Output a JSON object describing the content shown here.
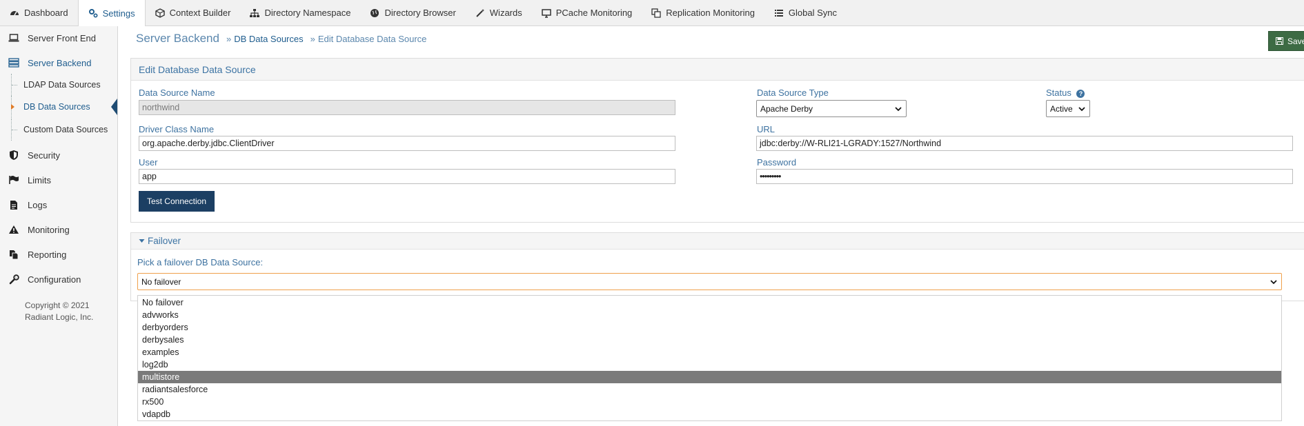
{
  "topnav": {
    "tabs": [
      {
        "label": "Dashboard",
        "icon": "dashboard-icon"
      },
      {
        "label": "Settings",
        "icon": "gears-icon"
      },
      {
        "label": "Context Builder",
        "icon": "cube-icon"
      },
      {
        "label": "Directory Namespace",
        "icon": "sitemap-icon"
      },
      {
        "label": "Directory Browser",
        "icon": "globe-icon"
      },
      {
        "label": "Wizards",
        "icon": "magic-wand-icon"
      },
      {
        "label": "PCache Monitoring",
        "icon": "monitor-icon"
      },
      {
        "label": "Replication Monitoring",
        "icon": "replication-icon"
      },
      {
        "label": "Global Sync",
        "icon": "list-icon"
      }
    ],
    "active_index": 1
  },
  "sidebar": {
    "items": [
      {
        "label": "Server Front End",
        "icon": "laptop-icon"
      },
      {
        "label": "Server Backend",
        "icon": "server-icon"
      },
      {
        "label": "Security",
        "icon": "shield-icon"
      },
      {
        "label": "Limits",
        "icon": "flag-icon"
      },
      {
        "label": "Logs",
        "icon": "file-icon"
      },
      {
        "label": "Monitoring",
        "icon": "warning-icon"
      },
      {
        "label": "Reporting",
        "icon": "report-icon"
      },
      {
        "label": "Configuration",
        "icon": "wrench-icon"
      }
    ],
    "subitems": [
      {
        "label": "LDAP Data Sources"
      },
      {
        "label": "DB Data Sources"
      },
      {
        "label": "Custom Data Sources"
      }
    ],
    "copyright": "Copyright © 2021 Radiant Logic, Inc."
  },
  "breadcrumb": {
    "root": "Server Backend",
    "sep1": "»",
    "link": "DB Data Sources",
    "sep2": "»",
    "current": "Edit Database Data Source"
  },
  "save_label": "Save",
  "edit_panel": {
    "title": "Edit Database Data Source",
    "ds_name_label": "Data Source Name",
    "ds_name_value": "northwind",
    "ds_type_label": "Data Source Type",
    "ds_type_value": "Apache Derby",
    "status_label": "Status",
    "status_value": "Active",
    "driver_label": "Driver Class Name",
    "driver_value": "org.apache.derby.jdbc.ClientDriver",
    "url_label": "URL",
    "url_value": "jdbc:derby://W-RLI21-LGRADY:1527/Northwind",
    "user_label": "User",
    "user_value": "app",
    "password_label": "Password",
    "password_value": "•••••••••",
    "test_button": "Test Connection"
  },
  "failover_panel": {
    "title": "Failover",
    "pick_label": "Pick a failover DB Data Source:",
    "selected_value": "No failover",
    "options": [
      "No failover",
      "advworks",
      "derbyorders",
      "derbysales",
      "examples",
      "log2db",
      "multistore",
      "radiantsalesforce",
      "rx500",
      "vdapdb"
    ],
    "highlighted_index": 6
  },
  "colors": {
    "accent": "#1f5d8e",
    "save_button": "#3d6b44",
    "primary_button": "#1c3f63",
    "focus_border": "#f0a04b",
    "highlight": "#7a7a7a"
  }
}
